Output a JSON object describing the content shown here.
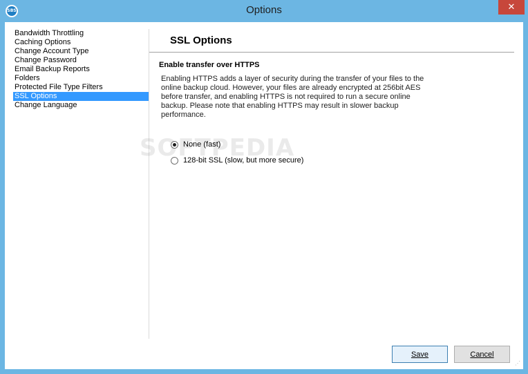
{
  "window": {
    "title": "Options",
    "app_icon_text": "SBS",
    "close_glyph": "✕"
  },
  "nav": {
    "items": [
      {
        "label": "Bandwidth Throttling"
      },
      {
        "label": "Caching Options"
      },
      {
        "label": "Change Account Type"
      },
      {
        "label": "Change Password"
      },
      {
        "label": "Email Backup Reports"
      },
      {
        "label": "Folders"
      },
      {
        "label": "Protected File Type Filters"
      },
      {
        "label": "SSL Options",
        "selected": true
      },
      {
        "label": "Change Language"
      }
    ],
    "selected_color": "#3399ff"
  },
  "panel": {
    "title": "SSL Options",
    "section_heading": "Enable transfer over HTTPS",
    "description_lines": [
      "Enabling HTTPS adds a layer of security during the transfer of your files to the",
      "online backup cloud. However, your files are already encrypted at 256bit AES",
      "before transfer, and enabling HTTPS is not required to run a secure online",
      "backup. Please note that enabling HTTPS may result in slower backup",
      "performance."
    ],
    "options": [
      {
        "label": "None (fast)",
        "checked": true
      },
      {
        "label": "128-bit SSL (slow, but more secure)",
        "checked": false
      }
    ]
  },
  "watermark": "SOFTPEDIA",
  "buttons": {
    "save_label": "Save",
    "cancel_label": "Cancel"
  },
  "colors": {
    "titlebar": "#6cb6e3",
    "close_button": "#c7473b"
  }
}
